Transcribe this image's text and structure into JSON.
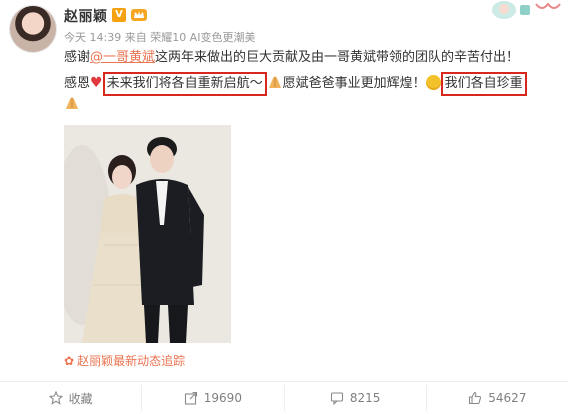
{
  "post": {
    "user_name": "赵丽颖",
    "verified_badge": "V",
    "meta": "今天 14:39 来自 荣耀10 AI变色更潮美",
    "text_line1_pre": "感谢",
    "mention": "@一哥黄斌",
    "text_line1_post": "这两年来做出的巨大贡献及由一哥黄斌带领的团队的辛苦付出！",
    "text_line2_pre": "感恩",
    "highlight1": "未来我们将各自重新启航～",
    "text_line2_mid": "愿斌爸爸事业更加辉煌！",
    "highlight2": "我们各自珍重",
    "follow_text": "赵丽颖最新动态追踪"
  },
  "actions": [
    {
      "icon": "star-icon",
      "label": "收藏"
    },
    {
      "icon": "share-icon",
      "label": "19690"
    },
    {
      "icon": "comment-icon",
      "label": "8215"
    },
    {
      "icon": "like-icon",
      "label": "54627"
    }
  ],
  "colors": {
    "mention": "#eb7350",
    "highlight_border": "#d6281c",
    "meta": "#999999",
    "action_text": "#808080"
  }
}
